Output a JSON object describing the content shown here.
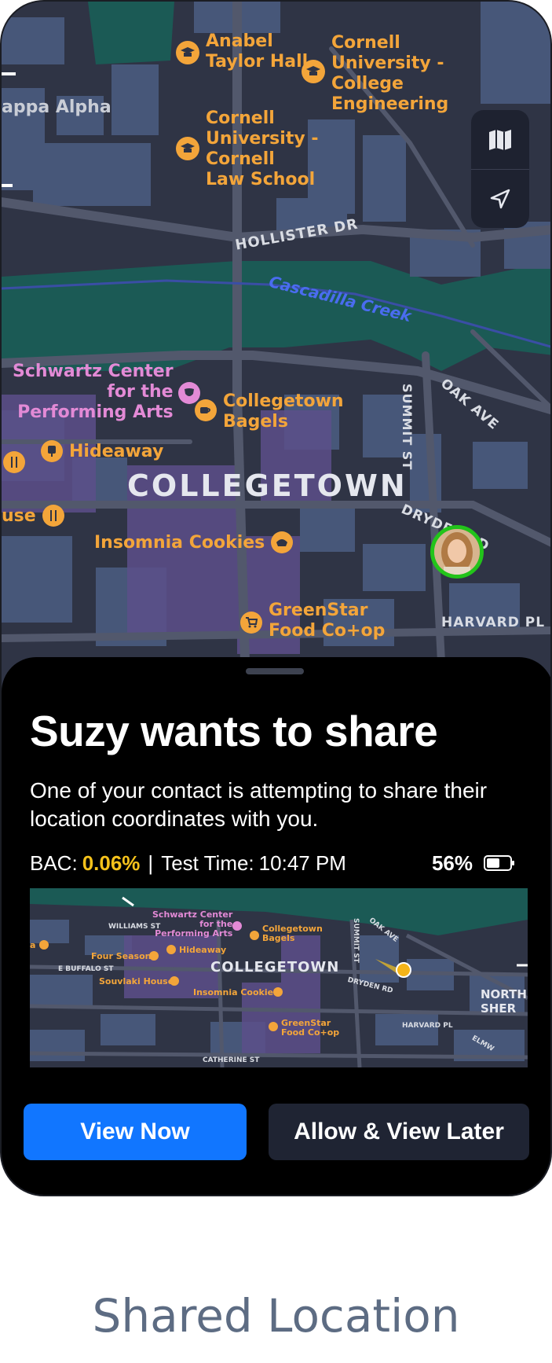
{
  "map": {
    "pois": [
      {
        "name": "Anabel\nTaylor Hall",
        "icon": "graduation-cap-icon"
      },
      {
        "name": "Cornell\nUniversity -\nCollege\nEngineering",
        "icon": "graduation-cap-icon"
      },
      {
        "name": "Cornell\nUniversity -\nCornell\nLaw School",
        "icon": "graduation-cap-icon"
      },
      {
        "name": "Schwartz Center\nfor the\nPerforming Arts",
        "icon": "theater-icon"
      },
      {
        "name": "Collegetown\nBagels",
        "icon": "coffee-icon"
      },
      {
        "name": "Hideaway",
        "icon": "bar-icon"
      },
      {
        "name": "Insomnia Cookies",
        "icon": "bakery-icon"
      },
      {
        "name": "GreenStar\nFood Co+op",
        "icon": "cart-icon"
      }
    ],
    "partial_labels": {
      "left_top": "appa Alpha",
      "left_house": "use"
    },
    "streets": {
      "hollister": "HOLLISTER DR",
      "summit": "SUMMIT ST",
      "oak": "OAK AVE",
      "dryden": "DRYDEN RD",
      "harvard": "HARVARD PL"
    },
    "water": "Cascadilla Creek",
    "district": "COLLEGETOWN",
    "controls": {
      "map_icon": "map-icon",
      "locate_icon": "location-arrow-icon"
    },
    "avatar_icon": "contact-avatar"
  },
  "sheet": {
    "title": "Suzy wants to share",
    "description": "One of your contact is attempting to share their location coordinates with you.",
    "bac_label": "BAC:",
    "bac_value": "0.06%",
    "separator": "|",
    "test_time_label": "Test Time:",
    "test_time_value": "10:47 PM",
    "battery": "56%",
    "battery_icon": "battery-icon",
    "mini_map": {
      "pois": [
        "Schwartz Center\nfor the\nPerforming Arts",
        "Collegetown\nBagels",
        "Four Seasons",
        "Hideaway",
        "Souvlaki House",
        "Insomnia Cookies",
        "GreenStar\nFood Co+op"
      ],
      "streets": {
        "williams": "WILLIAMS ST",
        "buffalo": "E BUFFALO ST",
        "summit": "SUMMIT ST",
        "oak": "OAK AVE",
        "dryden": "DRYDEN RD",
        "harvard": "HARVARD PL",
        "catherine": "CATHERINE ST",
        "elmwood": "ELMW"
      },
      "district": "COLLEGETOWN",
      "north_label": "NORTH\nSHER",
      "partial_label": "a"
    },
    "primary_button": "View Now",
    "secondary_button": "Allow & View Later"
  },
  "caption": "Shared Location",
  "colors": {
    "accent_blue": "#1176ff",
    "bac_yellow": "#f5c21b",
    "poi_orange": "#f3a53a",
    "poi_pink": "#e38ad6",
    "avatar_ring": "#22c41a"
  }
}
